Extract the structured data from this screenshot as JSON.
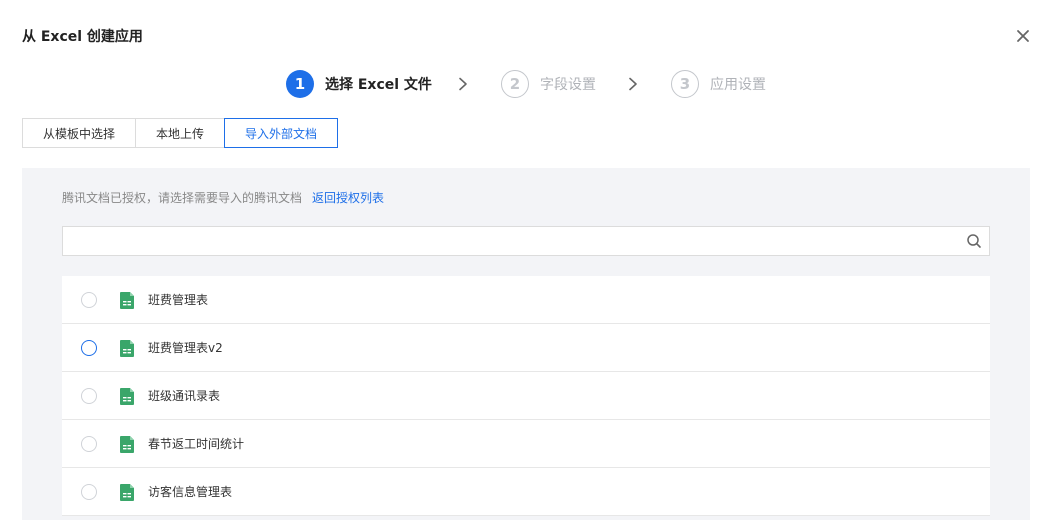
{
  "dialog": {
    "title": "从 Excel 创建应用"
  },
  "steps": [
    {
      "num": "1",
      "label": "选择 Excel 文件",
      "state": "active"
    },
    {
      "num": "2",
      "label": "字段设置",
      "state": "inactive"
    },
    {
      "num": "3",
      "label": "应用设置",
      "state": "inactive"
    }
  ],
  "tabs": [
    {
      "label": "从模板中选择",
      "active": false
    },
    {
      "label": "本地上传",
      "active": false
    },
    {
      "label": "导入外部文档",
      "active": true
    }
  ],
  "panel": {
    "hint": "腾讯文档已授权，请选择需要导入的腾讯文档",
    "back_link": "返回授权列表",
    "search_value": ""
  },
  "files": [
    {
      "name": "班费管理表"
    },
    {
      "name": "班费管理表v2"
    },
    {
      "name": "班级通讯录表"
    },
    {
      "name": "春节返工时间统计"
    },
    {
      "name": "访客信息管理表"
    }
  ],
  "colors": {
    "accent": "#1e6fe8",
    "panel_bg": "#f3f4f7",
    "sheet_green": "#3aa66a"
  },
  "icons": {
    "close": "close-icon",
    "search": "search-icon",
    "file": "sheet-file-icon",
    "step_arrow": "chevron-right-icon"
  }
}
